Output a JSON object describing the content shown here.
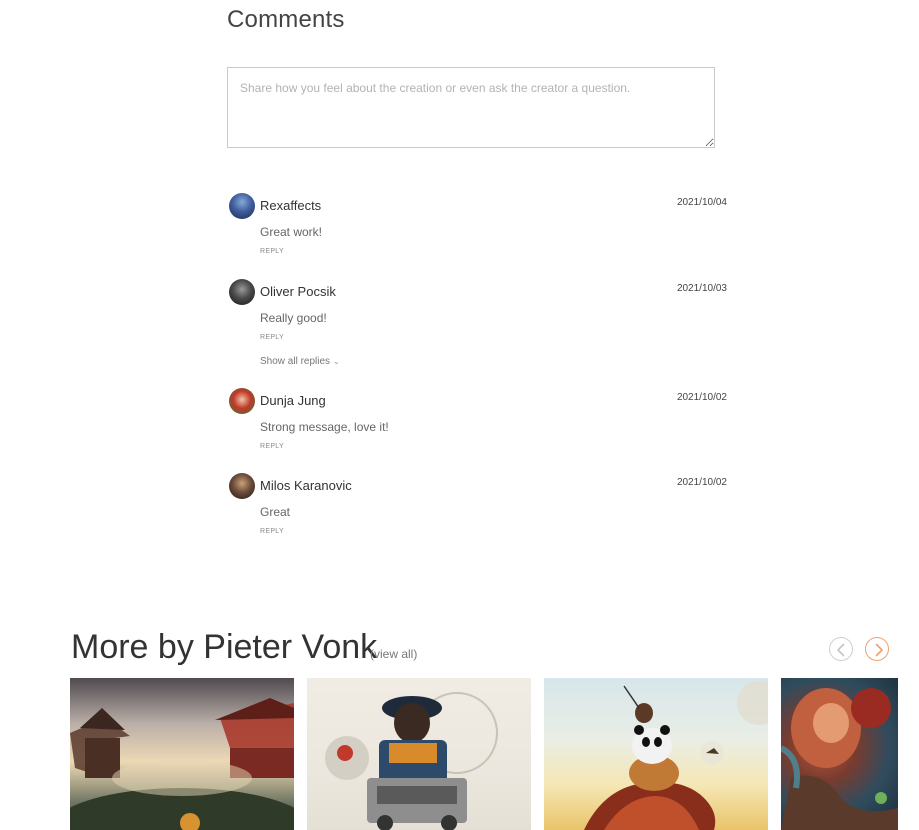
{
  "comments": {
    "title": "Comments",
    "input_placeholder": "Share how you feel about the creation or even ask the creator a question.",
    "reply_label": "REPLY",
    "show_replies_label": "Show all replies",
    "items": [
      {
        "author": "Rexaffects",
        "date": "2021/10/04",
        "text": "Great work!"
      },
      {
        "author": "Oliver Pocsik",
        "date": "2021/10/03",
        "text": "Really good!"
      },
      {
        "author": "Dunja Jung",
        "date": "2021/10/02",
        "text": "Strong message, love it!"
      },
      {
        "author": "Milos Karanovic",
        "date": "2021/10/02",
        "text": "Great"
      }
    ]
  },
  "more": {
    "title": "More by Pieter Vonk",
    "view_all_label": "(view all)",
    "prev_icon": "chevron-left-icon",
    "next_icon": "chevron-right-icon"
  },
  "colors": {
    "accent": "#f0a070",
    "border": "#c9c9c9"
  }
}
